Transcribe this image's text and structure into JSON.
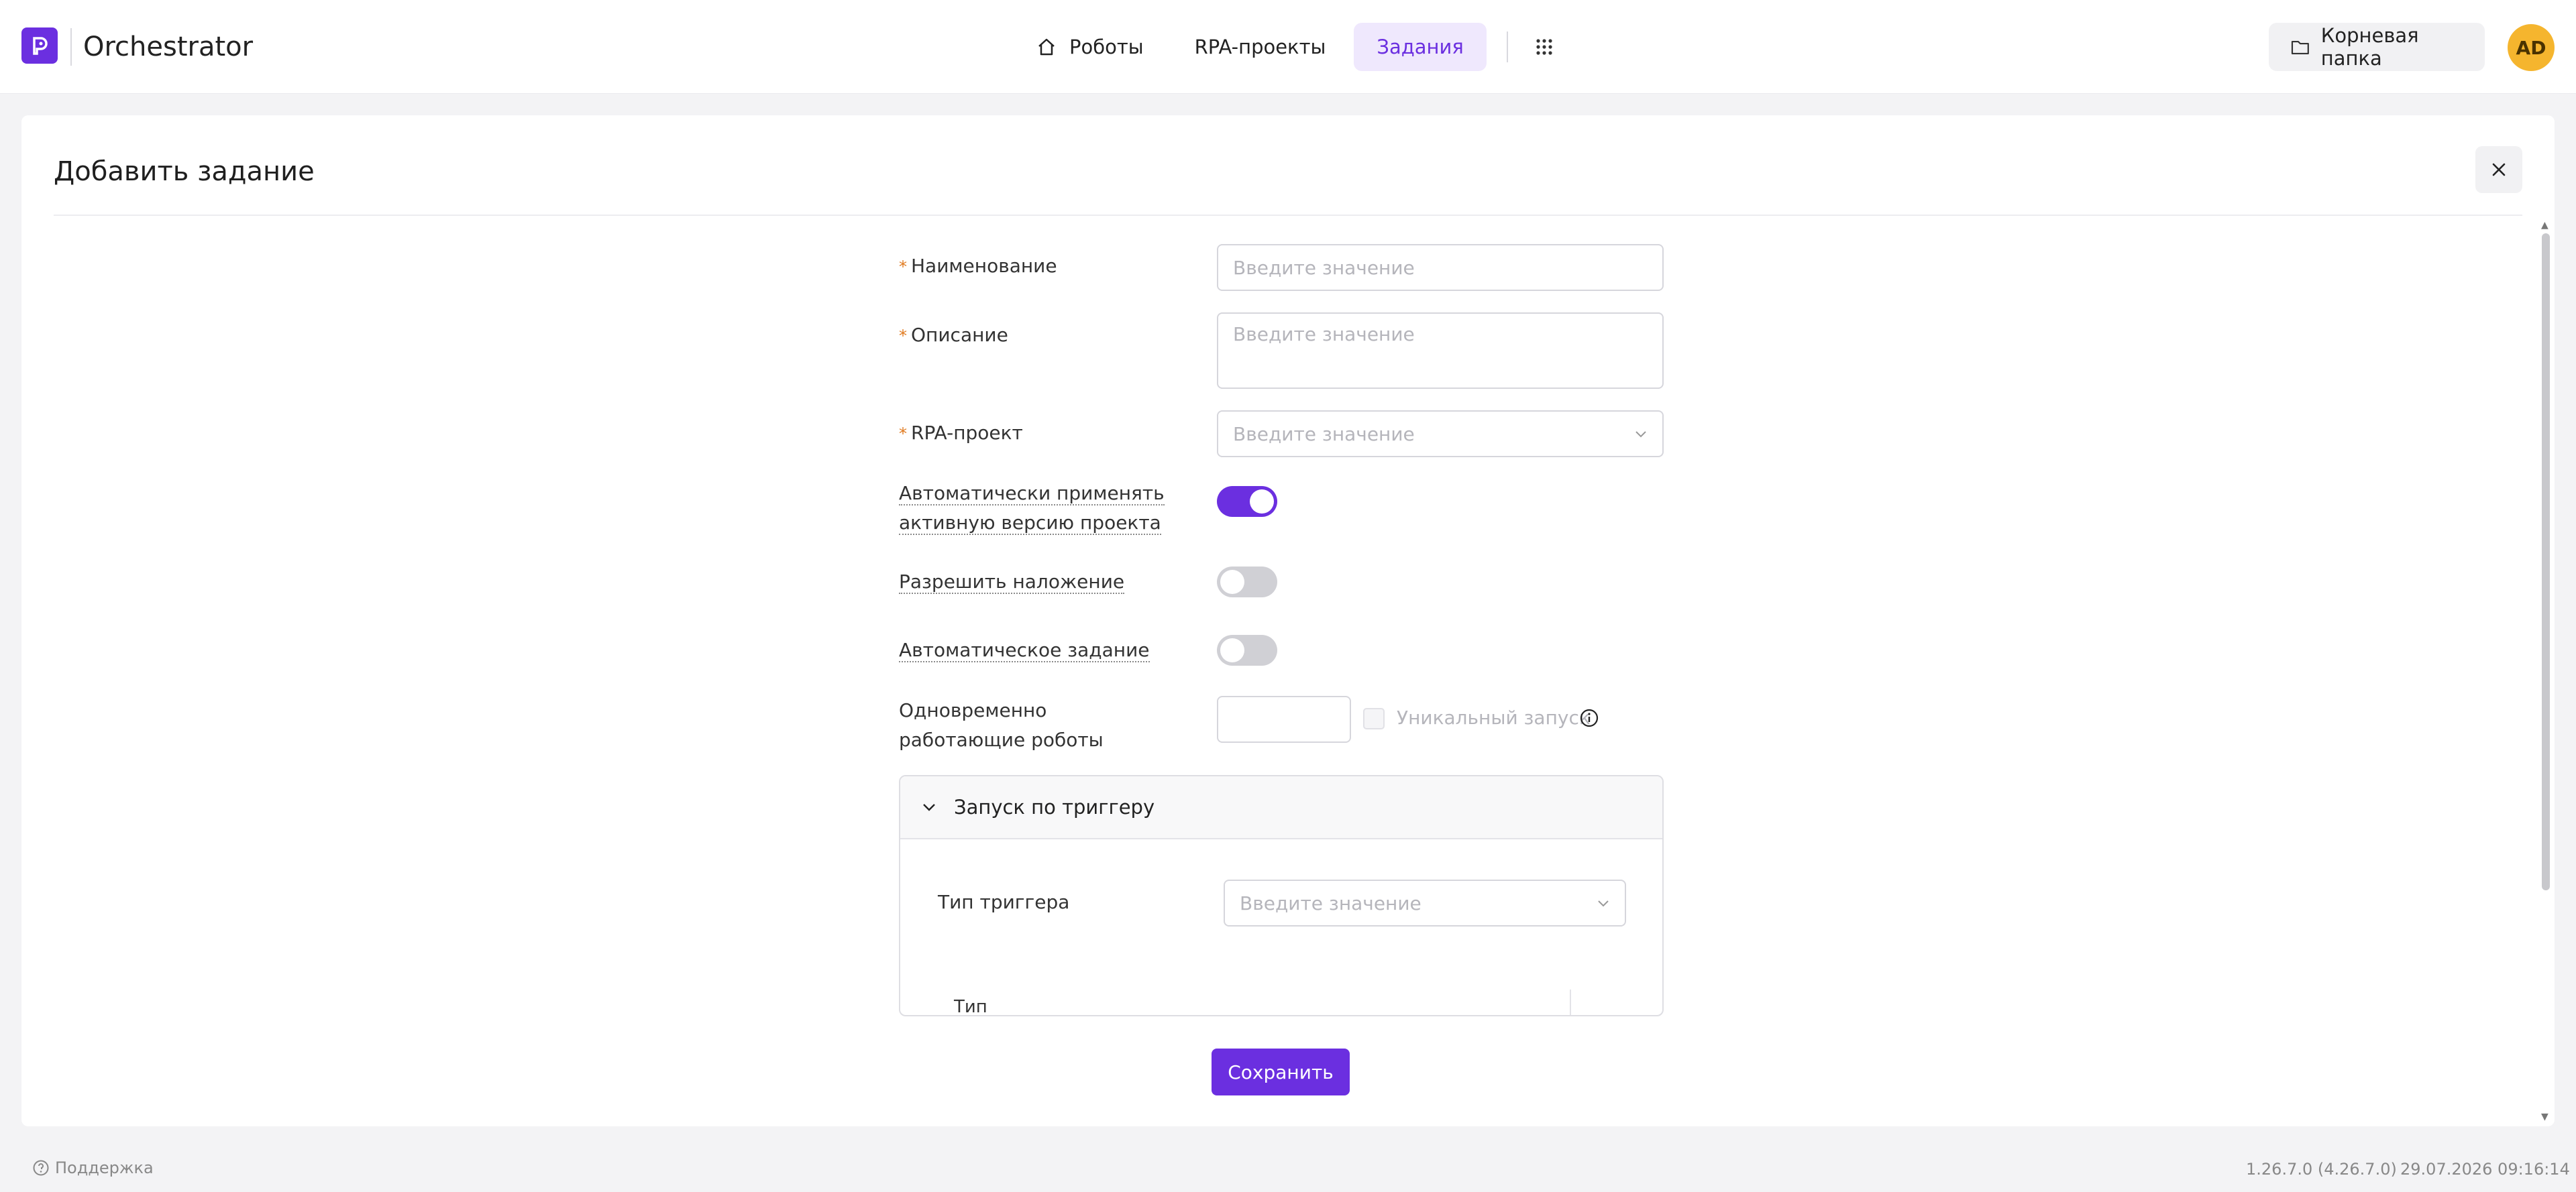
{
  "header": {
    "app_title": "Orchestrator",
    "nav": [
      {
        "label": "Роботы",
        "icon": "home-icon"
      },
      {
        "label": "RPA-проекты"
      },
      {
        "label": "Задания",
        "active": true
      }
    ],
    "root_folder_label": "Корневая папка",
    "avatar_initials": "AD"
  },
  "modal": {
    "title": "Добавить задание",
    "form": {
      "name_label": "Наименование",
      "name_placeholder": "Введите значение",
      "description_label": "Описание",
      "description_placeholder": "Введите значение",
      "project_label": "RPA-проект",
      "project_placeholder": "Введите значение",
      "auto_apply_label_1": "Автоматически применять",
      "auto_apply_label_2": "активную версию проекта",
      "auto_apply_on": true,
      "allow_overlap_label": "Разрешить наложение",
      "allow_overlap_on": false,
      "auto_task_label": "Автоматическое задание",
      "auto_task_on": false,
      "concurrent_label_1": "Одновременно",
      "concurrent_label_2": "работающие роботы",
      "unique_run_label": "Уникальный запуск"
    },
    "trigger": {
      "section_title": "Запуск по триггеру",
      "type_label": "Тип триггера",
      "type_placeholder": "Введите значение",
      "column_header": "Тип"
    },
    "save_label": "Сохранить"
  },
  "footer": {
    "support_label": "Поддержка",
    "version": "1.26.7.0 (4.26.7.0)",
    "timestamp": "29.07.2026 09:16:14"
  },
  "colors": {
    "accent": "#6b2fe0",
    "avatar": "#f5b52e",
    "required_mark": "#e07a1f"
  }
}
